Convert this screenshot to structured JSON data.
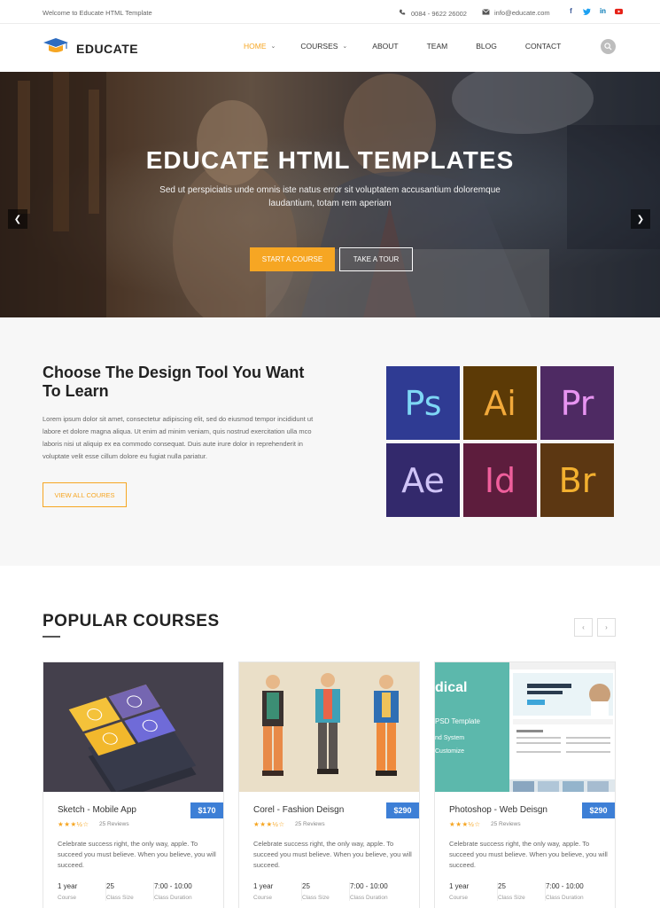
{
  "topbar": {
    "welcome": "Welcome to Educate HTML Template",
    "phone": "0084 - 9622 26002",
    "email": "info@educate.com",
    "social": [
      "facebook-icon",
      "twitter-icon",
      "linkedin-icon",
      "youtube-icon"
    ]
  },
  "brand": {
    "name": "EDUCATE",
    "accent": "#f6a623",
    "price_blue": "#3d7fd6"
  },
  "nav": {
    "home": "HOME",
    "courses": "COURSES",
    "about": "ABOUT",
    "team": "TEAM",
    "blog": "BLOG",
    "contact": "CONTACT"
  },
  "hero": {
    "title": "EDUCATE HTML TEMPLATES",
    "subtitle": "Sed ut perspiciatis unde omnis iste natus error sit voluptatem accusantium doloremque laudantium, totam rem aperiam",
    "primary_btn": "START A COURSE",
    "secondary_btn": "TAKE A TOUR"
  },
  "tools": {
    "title": "Choose The Design Tool You Want To Learn",
    "text": "Lorem ipsum dolor sit amet, consectetur adipiscing elit, sed do eiusmod tempor incididunt ut labore et dolore magna aliqua. Ut enim ad minim veniam, quis nostrud exercitation ulla mco laboris nisi ut aliquip ex ea commodo consequat. Duis aute irure dolor in reprehenderit in voluptate velit esse cillum dolore eu fugiat nulla pariatur.",
    "button": "VIEW ALL COURES",
    "tiles": [
      {
        "label": "Ps",
        "bg": "#2f3b93",
        "fg": "#7ed7f5"
      },
      {
        "label": "Ai",
        "bg": "#5c3a06",
        "fg": "#f2a93a"
      },
      {
        "label": "Pr",
        "bg": "#4e2a63",
        "fg": "#e794f1"
      },
      {
        "label": "Ae",
        "bg": "#33296c",
        "fg": "#cfc3f7"
      },
      {
        "label": "Id",
        "bg": "#5d1d3d",
        "fg": "#ef5f9c"
      },
      {
        "label": "Br",
        "bg": "#5c3712",
        "fg": "#f3b02f"
      }
    ]
  },
  "popular": {
    "title": "POPULAR COURSES",
    "prev": "‹",
    "next": "›",
    "courses": [
      {
        "title": "Sketch - Mobile App",
        "price": "$170",
        "stars": "★★★½☆",
        "reviews": "25 Reviews",
        "text": "Celebrate success right, the only way, apple. To succeed you must believe. When you believe, you will succeed.",
        "duration": "1 year",
        "duration_label": "Course",
        "size": "25",
        "size_label": "Class Size",
        "time": "7:00 - 10:00",
        "time_label": "Class Duration"
      },
      {
        "title": "Corel - Fashion Deisgn",
        "price": "$290",
        "stars": "★★★½☆",
        "reviews": "25 Reviews",
        "text": "Celebrate success right, the only way, apple. To succeed you must believe. When you believe, you will succeed.",
        "duration": "1 year",
        "duration_label": "Course",
        "size": "25",
        "size_label": "Class Size",
        "time": "7:00 - 10:00",
        "time_label": "Class Duration"
      },
      {
        "title": "Photoshop - Web Deisgn",
        "price": "$290",
        "stars": "★★★½☆",
        "reviews": "25 Reviews",
        "text": "Celebrate success right, the only way, apple. To succeed you must believe. When you believe, you will succeed.",
        "duration": "1 year",
        "duration_label": "Course",
        "size": "25",
        "size_label": "Class Size",
        "time": "7:00 - 10:00",
        "time_label": "Class Duration",
        "image_text": {
          "headline": "dical",
          "sub1": "PSD Template",
          "sub2": "nd System",
          "sub3": "Customize"
        }
      }
    ]
  }
}
